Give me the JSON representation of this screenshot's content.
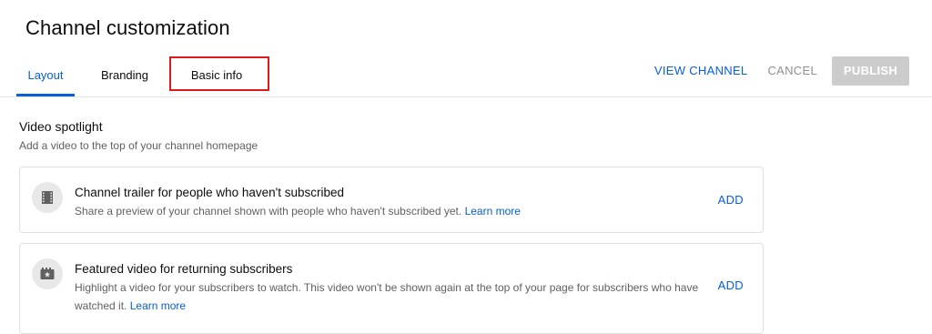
{
  "header": {
    "title": "Channel customization",
    "tabs": [
      {
        "label": "Layout",
        "active": true
      },
      {
        "label": "Branding",
        "active": false
      },
      {
        "label": "Basic info",
        "active": false
      }
    ],
    "actions": {
      "view_channel": "VIEW CHANNEL",
      "cancel": "CANCEL",
      "publish": "PUBLISH"
    }
  },
  "video_spotlight": {
    "title": "Video spotlight",
    "description": "Add a video to the top of your channel homepage",
    "cards": [
      {
        "icon": "film-icon",
        "title": "Channel trailer for people who haven't subscribed",
        "description": "Share a preview of your channel shown with people who haven't subscribed yet.",
        "learn_more": "Learn more",
        "add": "ADD"
      },
      {
        "icon": "featured-video-icon",
        "title": "Featured video for returning subscribers",
        "description": "Highlight a video for your subscribers to watch. This video won't be shown again at the top of your page for subscribers who have watched it.",
        "learn_more": "Learn more",
        "add": "ADD"
      }
    ]
  },
  "colors": {
    "accent": "#065fd4",
    "highlight_box": "#e01a1a",
    "publish_disabled": "#cccccc",
    "muted_text": "#606060"
  }
}
